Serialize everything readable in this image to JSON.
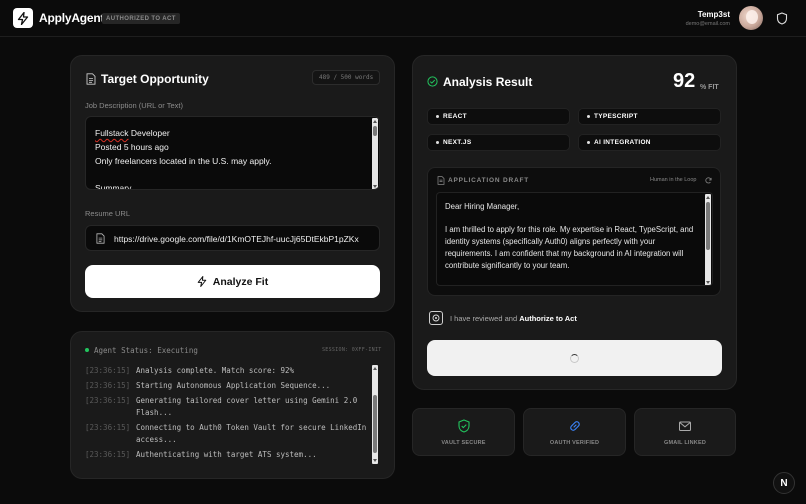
{
  "header": {
    "app_name": "ApplyAgent",
    "badge": "AUTHORIZED TO ACT",
    "user_name": "Temp3st",
    "user_email": "demo@email.com"
  },
  "target": {
    "title": "Target Opportunity",
    "word_count": "489 / 500 words",
    "jd_label": "Job Description (URL or Text)",
    "jd_line1_pre": "",
    "jd_line1_spell": "Fullstack",
    "jd_line1_post": " Developer",
    "jd_rest": "Posted 5 hours ago\nOnly freelancers located in the U.S. may apply.\n\nSummary",
    "resume_label": "Resume URL",
    "resume_url": "https://drive.google.com/file/d/1KmOTEJhf-uucJj65DtEkbP1pZKx",
    "analyze_label": "Analyze Fit"
  },
  "agent": {
    "status": "Agent Status: Executing",
    "session": "SESSION: 0XFF-INIT",
    "logs": [
      {
        "time": "[23:36:15]",
        "msg": "Analysis complete. Match score: 92%"
      },
      {
        "time": "[23:36:15]",
        "msg": "Starting Autonomous Application Sequence..."
      },
      {
        "time": "[23:36:15]",
        "msg": "Generating tailored cover letter using Gemini 2.0 Flash..."
      },
      {
        "time": "[23:36:15]",
        "msg": "Connecting to Auth0 Token Vault for secure LinkedIn access..."
      },
      {
        "time": "[23:36:15]",
        "msg": "Authenticating with target ATS system..."
      }
    ]
  },
  "result": {
    "title": "Analysis Result",
    "score": "92",
    "fit_label": "% FIT",
    "tags": [
      "REACT",
      "TYPESCRIPT",
      "NEXT.JS",
      "AI INTEGRATION"
    ],
    "draft_label": "APPLICATION DRAFT",
    "hitl_label": "Human in the Loop",
    "draft_text": "Dear Hiring Manager,\n\nI am thrilled to apply for this role. My expertise in React, TypeScript, and identity systems (specifically Auth0) aligns perfectly with your requirements. I am confident that my background in AI integration will contribute significantly to your team.\n\nLooking forward to speaking with you.",
    "review_pre": "I have reviewed and ",
    "review_bold": "Authorize to Act"
  },
  "badges": {
    "vault": "VAULT SECURE",
    "oauth": "OAUTH VERIFIED",
    "gmail": "GMAIL LINKED"
  },
  "colors": {
    "accent_green": "#22c55e",
    "background": "#0b0b0b",
    "panel": "#1a1a1a"
  }
}
